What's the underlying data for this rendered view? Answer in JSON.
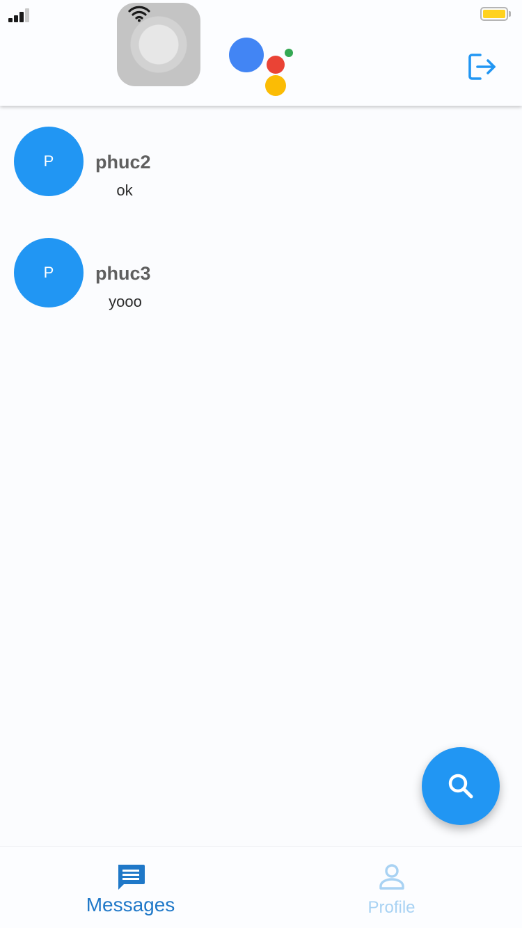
{
  "header": {
    "actions": {
      "logout_icon": "logout-icon"
    }
  },
  "colors": {
    "accent": "#2196f3",
    "nav_active": "#1f78c8",
    "nav_inactive": "#a8d2f3",
    "battery": "#ffd21f",
    "assistant_blue": "#4285f4",
    "assistant_red": "#ea4335",
    "assistant_yellow": "#fbbc05",
    "assistant_green": "#34a853"
  },
  "chats": [
    {
      "avatar_letter": "P",
      "name": "phuc2",
      "last_message": "ok"
    },
    {
      "avatar_letter": "P",
      "name": "phuc3",
      "last_message": "yooo"
    }
  ],
  "fab": {
    "icon": "search-icon"
  },
  "bottom_nav": {
    "items": [
      {
        "label": "Messages",
        "icon": "message-icon",
        "active": true
      },
      {
        "label": "Profile",
        "icon": "person-icon",
        "active": false
      }
    ]
  }
}
